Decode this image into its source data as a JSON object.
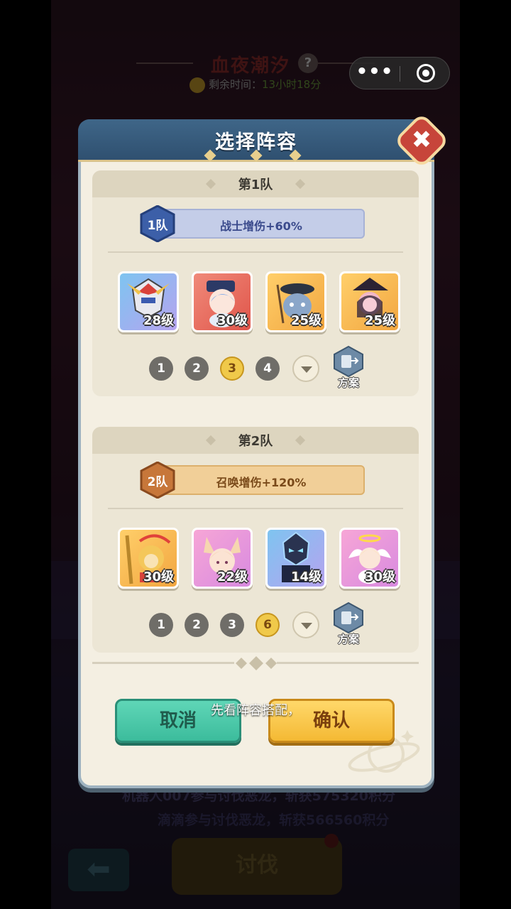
{
  "background": {
    "event_title": "血夜潮汐",
    "help_symbol": "?",
    "timer_label": "剩余时间：",
    "timer_value": "13小时18分",
    "log_line_1": "机器人007参与讨伐恶龙，斩获575320积分",
    "log_line_2": "滴滴参与讨伐恶龙，斩获566560积分",
    "back_symbol": "⬅",
    "attack_label": "讨伐"
  },
  "capsule": {
    "more_symbol": "•••"
  },
  "dialog": {
    "title": "选择阵容",
    "close_symbol": "✖",
    "cancel_label": "取消",
    "confirm_label": "确认"
  },
  "teams": [
    {
      "title": "第1队",
      "badge": "1队",
      "buff": "战士增伤+60%",
      "heroes": [
        {
          "level": "28级"
        },
        {
          "level": "30级"
        },
        {
          "level": "25级"
        },
        {
          "level": "25级"
        }
      ],
      "slots": [
        "1",
        "2",
        "3",
        "4"
      ],
      "selected_slot": "3",
      "plan_label": "方案"
    },
    {
      "title": "第2队",
      "badge": "2队",
      "buff": "召唤增伤+120%",
      "heroes": [
        {
          "level": "30级"
        },
        {
          "level": "22级"
        },
        {
          "level": "14级"
        },
        {
          "level": "30级"
        }
      ],
      "slots": [
        "1",
        "2",
        "3",
        "6"
      ],
      "selected_slot": "6",
      "plan_label": "方案"
    }
  ],
  "subtitle": "先看阵容搭配，",
  "colors": {
    "team1_badge": "#3c5fa8",
    "team2_badge": "#c7773a",
    "cancel": "#3cbc9c",
    "confirm": "#f4b934",
    "header": "#3f6688"
  }
}
